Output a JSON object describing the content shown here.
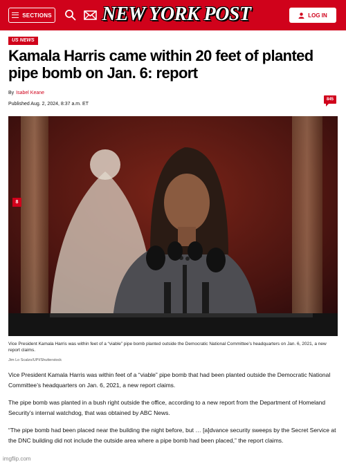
{
  "header": {
    "sections_label": "SECTIONS",
    "logo_text": "NEW YORK POST",
    "login_label": "LOG IN",
    "brand_color": "#d0021b"
  },
  "article": {
    "category_tag": "US NEWS",
    "headline": "Kamala Harris came within 20 feet of planted pipe bomb on Jan. 6: report",
    "byline_prefix": "By",
    "author": "Isabel Keane",
    "published": "Published Aug. 2, 2024, 8:37 a.m. ET",
    "comment_count": "845",
    "gallery_count": "8",
    "image_caption": "Vice President Kamala Harris was within feet of a “viable” pipe bomb planted outside the Democratic National Committee’s headquarters on Jan. 6, 2021, a new report claims.",
    "image_credit": "Jim Lo Scalzo/UPI/Shutterstock",
    "paragraphs": [
      "Vice President Kamala Harris was within feet of a “viable” pipe bomb that had been planted outside the Democratic National Committee’s headquarters on Jan. 6, 2021, a new report claims.",
      "The pipe bomb was planted in a bush right outside the office, according to a new report from the Department of Homeland Security’s internal watchdog, that was obtained by ABC News.",
      "“The pipe bomb had been placed near the building the night before, but … [a]dvance security sweeps by the Secret Service at the DNC building did not include the outside area where a pipe bomb had been placed,” the report claims."
    ]
  },
  "icons": [
    "hamburger-icon",
    "search-icon",
    "mail-icon",
    "user-icon",
    "comment-icon",
    "gallery-icon"
  ],
  "watermark": "imgflip.com"
}
